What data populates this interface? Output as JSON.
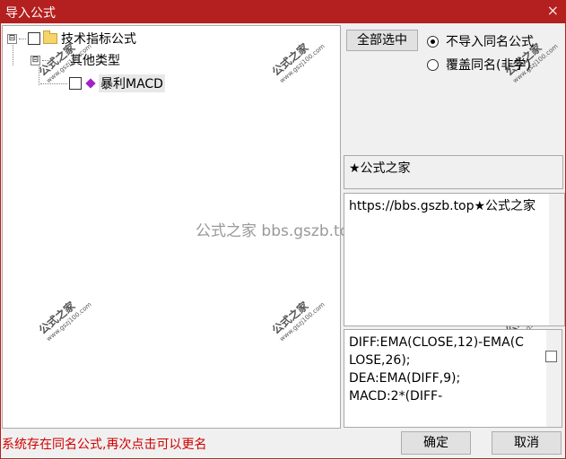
{
  "window": {
    "title": "导入公式",
    "close_glyph": "×"
  },
  "tree": {
    "root": {
      "expander": "⊟",
      "label": "技术指标公式"
    },
    "group": {
      "expander": "⊟",
      "label": "其他类型"
    },
    "item": {
      "label": "暴利MACD"
    }
  },
  "watermark": {
    "text": "公式之家",
    "url": "www.gszj100.com",
    "center": "公式之家 bbs.gszb.top"
  },
  "options": {
    "select_all_label": "全部选中",
    "no_import_label": "不导入同名公式",
    "overwrite_label": "覆盖同名(非学)",
    "selected": "no_import"
  },
  "panels": {
    "author": "★公式之家",
    "description": "https://bbs.gszb.top★公式之家",
    "code": "DIFF:EMA(CLOSE,12)-EMA(CLOSE,26);\nDEA:EMA(DIFF,9);\nMACD:2*(DIFF-"
  },
  "status_message": "系统存在同名公式,再次点击可以更名",
  "buttons": {
    "ok_label": "确定",
    "cancel_label": "取消"
  }
}
